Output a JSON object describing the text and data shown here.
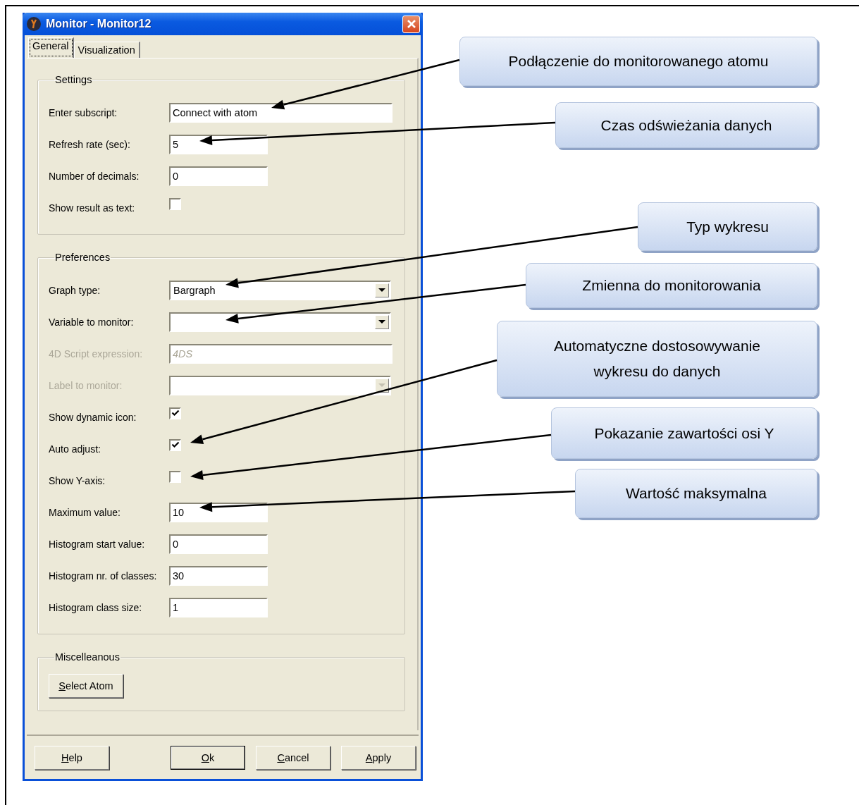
{
  "window": {
    "title": "Monitor - Monitor12"
  },
  "tabs": [
    {
      "label": "General",
      "selected": true
    },
    {
      "label": "Visualization",
      "selected": false
    }
  ],
  "groups": [
    {
      "title": "Settings",
      "fields": [
        {
          "kind": "text-wide",
          "label": "Enter subscript:",
          "value": "Connect with atom",
          "disabled": false
        },
        {
          "kind": "text",
          "label": "Refresh rate (sec):",
          "value": "5",
          "disabled": false
        },
        {
          "kind": "text",
          "label": "Number of decimals:",
          "value": "0",
          "disabled": false
        },
        {
          "kind": "checkbox",
          "label": "Show result as text:",
          "checked": false,
          "disabled": false
        }
      ]
    },
    {
      "title": "Preferences",
      "fields": [
        {
          "kind": "dropdown",
          "label": "Graph type:",
          "value": "Bargraph",
          "disabled": false
        },
        {
          "kind": "dropdown",
          "label": "Variable to monitor:",
          "disabled": false
        },
        {
          "kind": "text-wide",
          "label": "4D Script expression:",
          "placeholder": "4DS",
          "disabled": true
        },
        {
          "kind": "dropdown",
          "label": "Label to monitor:",
          "disabled": true
        },
        {
          "kind": "checkbox",
          "label": "Show dynamic icon:",
          "checked": true,
          "disabled": false
        },
        {
          "kind": "checkbox",
          "label": "Auto adjust:",
          "checked": true,
          "disabled": false
        },
        {
          "kind": "checkbox",
          "label": "Show Y-axis:",
          "checked": false,
          "disabled": false
        },
        {
          "kind": "text",
          "label": "Maximum value:",
          "value": "10",
          "disabled": false
        },
        {
          "kind": "text",
          "label": "Histogram start value:",
          "value": "0",
          "disabled": false
        },
        {
          "kind": "text",
          "label": "Histogram nr. of classes:",
          "value": "30",
          "disabled": false
        },
        {
          "kind": "text",
          "label": "Histogram class size:",
          "value": "1",
          "disabled": false
        }
      ]
    }
  ],
  "miscellaneous": {
    "title": "Miscelleanous",
    "button": {
      "label": "Select Atom",
      "mnemonic": true
    }
  },
  "buttons": [
    {
      "label": "Help",
      "mnemonic": true,
      "default": false
    },
    {
      "label": "Ok",
      "mnemonic": true,
      "default": true
    },
    {
      "label": "Cancel",
      "mnemonic": true,
      "default": false
    },
    {
      "label": "Apply",
      "mnemonic": true,
      "default": false
    }
  ],
  "callouts": [
    {
      "text": "Podłączenie do monitorowanego atomu"
    },
    {
      "text": "Czas odświeżania danych"
    },
    {
      "text": "Typ wykresu"
    },
    {
      "text": "Zmienna do monitorowania"
    },
    {
      "text": "Automatyczne dostosowywanie wykresu do danych"
    },
    {
      "text": "Pokazanie zawartości osi Y"
    },
    {
      "text": "Wartość maksymalna"
    }
  ]
}
